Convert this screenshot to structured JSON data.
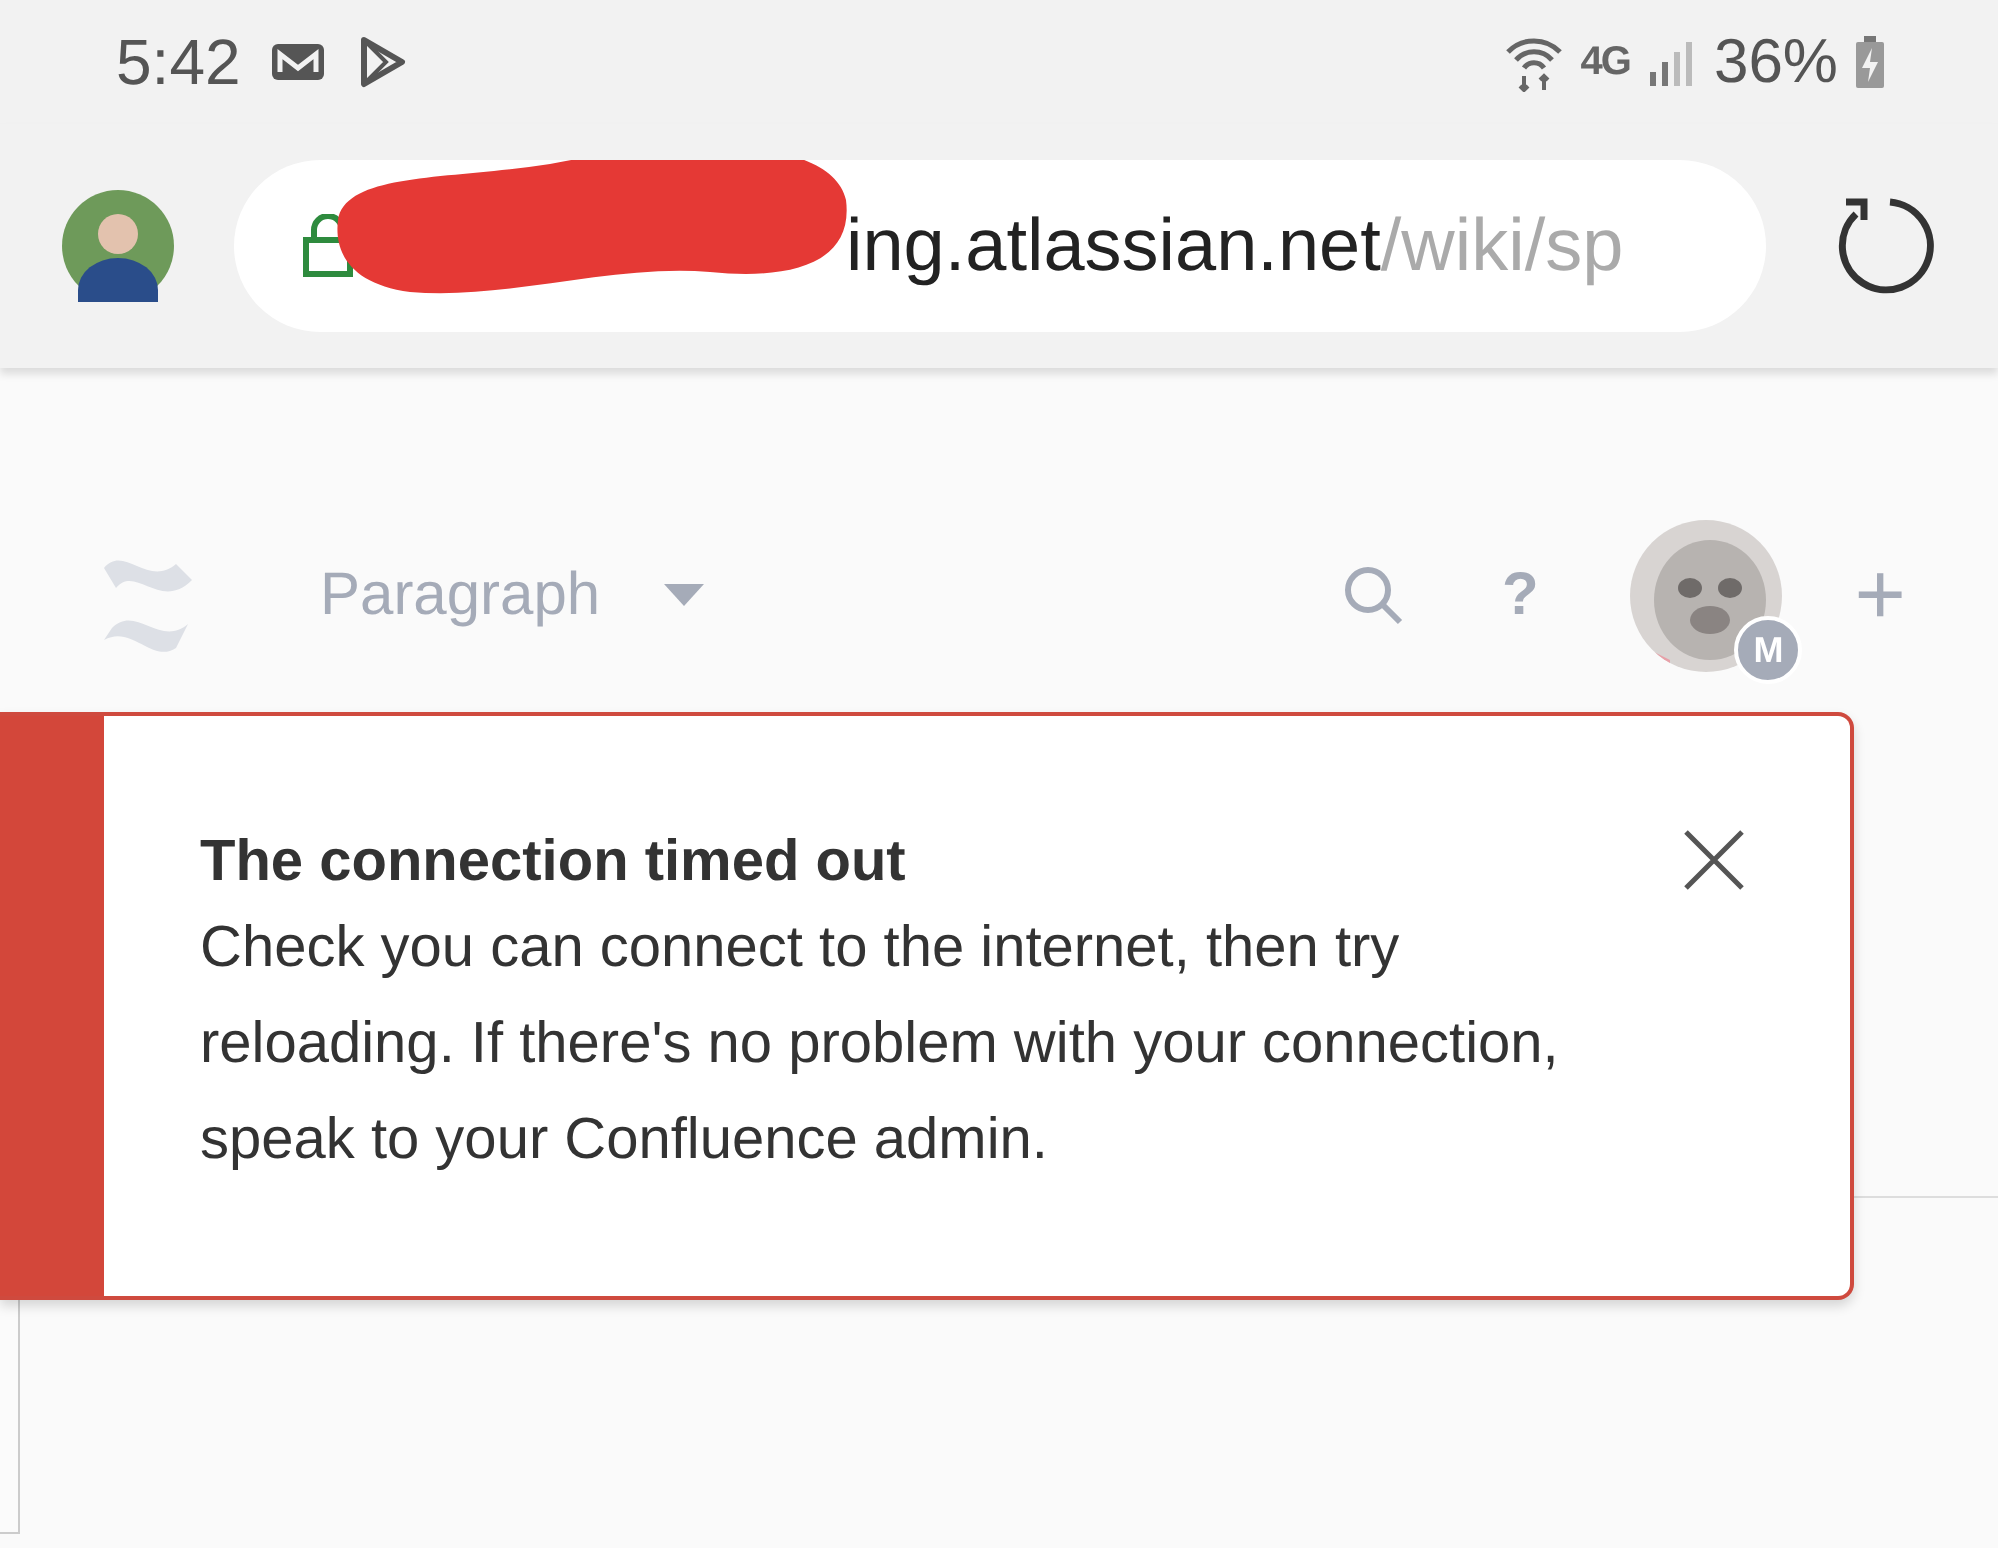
{
  "status_bar": {
    "time": "5:42",
    "network_type": "4G",
    "battery": "36%"
  },
  "browser": {
    "url_host": "ing.atlassian.net",
    "url_path": "/wiki/sp",
    "secure": true
  },
  "editor": {
    "style_dropdown": "Paragraph",
    "help": "?",
    "avatar_badge": "M",
    "add": "+"
  },
  "error_banner": {
    "title": "The connection timed out",
    "message": "Check you can connect to the internet, then try reloading. If there's no problem with your connection, speak to your Confluence admin."
  }
}
